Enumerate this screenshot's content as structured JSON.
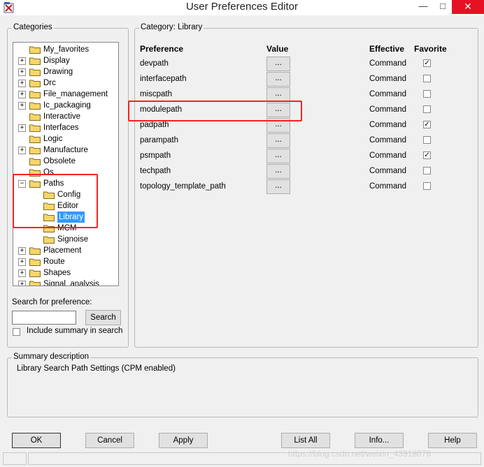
{
  "window": {
    "title": "User Preferences Editor",
    "controls": {
      "minimize": "—",
      "maximize": "□",
      "close": "✕"
    }
  },
  "categories": {
    "label": "Categories",
    "tree": [
      {
        "label": "My_favorites",
        "expandable": false,
        "depth": 0
      },
      {
        "label": "Display",
        "expandable": true,
        "depth": 0
      },
      {
        "label": "Drawing",
        "expandable": true,
        "depth": 0
      },
      {
        "label": "Drc",
        "expandable": true,
        "depth": 0
      },
      {
        "label": "File_management",
        "expandable": true,
        "depth": 0
      },
      {
        "label": "Ic_packaging",
        "expandable": true,
        "depth": 0
      },
      {
        "label": "Interactive",
        "expandable": false,
        "depth": 0
      },
      {
        "label": "Interfaces",
        "expandable": true,
        "depth": 0
      },
      {
        "label": "Logic",
        "expandable": false,
        "depth": 0
      },
      {
        "label": "Manufacture",
        "expandable": true,
        "depth": 0
      },
      {
        "label": "Obsolete",
        "expandable": false,
        "depth": 0
      },
      {
        "label": "Os",
        "expandable": false,
        "depth": 0
      },
      {
        "label": "Paths",
        "expandable": true,
        "expanded": true,
        "depth": 0
      },
      {
        "label": "Config",
        "expandable": false,
        "depth": 1
      },
      {
        "label": "Editor",
        "expandable": false,
        "depth": 1
      },
      {
        "label": "Library",
        "expandable": false,
        "depth": 1,
        "selected": true
      },
      {
        "label": "MCM",
        "expandable": false,
        "depth": 1
      },
      {
        "label": "Signoise",
        "expandable": false,
        "depth": 1
      },
      {
        "label": "Placement",
        "expandable": true,
        "depth": 0
      },
      {
        "label": "Route",
        "expandable": true,
        "depth": 0
      },
      {
        "label": "Shapes",
        "expandable": true,
        "depth": 0
      },
      {
        "label": "Signal_analysis",
        "expandable": true,
        "depth": 0
      }
    ],
    "search_label": "Search for preference:",
    "search_value": "",
    "search_button": "Search",
    "include_summary_label": "Include summary in search",
    "include_summary_checked": false
  },
  "category_panel": {
    "label": "Category:  Library",
    "columns": {
      "preference": "Preference",
      "value": "Value",
      "effective": "Effective",
      "favorite": "Favorite"
    },
    "value_button_label": "...",
    "rows": [
      {
        "name": "devpath",
        "effective": "Command",
        "favorite": true
      },
      {
        "name": "interfacepath",
        "effective": "Command",
        "favorite": false
      },
      {
        "name": "miscpath",
        "effective": "Command",
        "favorite": false
      },
      {
        "name": "modulepath",
        "effective": "Command",
        "favorite": false,
        "highlighted": true
      },
      {
        "name": "padpath",
        "effective": "Command",
        "favorite": true
      },
      {
        "name": "parampath",
        "effective": "Command",
        "favorite": false
      },
      {
        "name": "psmpath",
        "effective": "Command",
        "favorite": true
      },
      {
        "name": "techpath",
        "effective": "Command",
        "favorite": false
      },
      {
        "name": "topology_template_path",
        "effective": "Command",
        "favorite": false
      }
    ]
  },
  "summary": {
    "label": "Summary description",
    "text": "Library Search Path Settings (CPM enabled)"
  },
  "buttons": {
    "ok": "OK",
    "cancel": "Cancel",
    "apply": "Apply",
    "list_all": "List All",
    "info": "Info...",
    "help": "Help"
  },
  "watermark": "https://blog.csdn.net/weixin_43918076",
  "colors": {
    "selection": "#3399ff",
    "annotation_red": "#ff2020",
    "close_button": "#e81123",
    "folder": "#f5d66b"
  }
}
